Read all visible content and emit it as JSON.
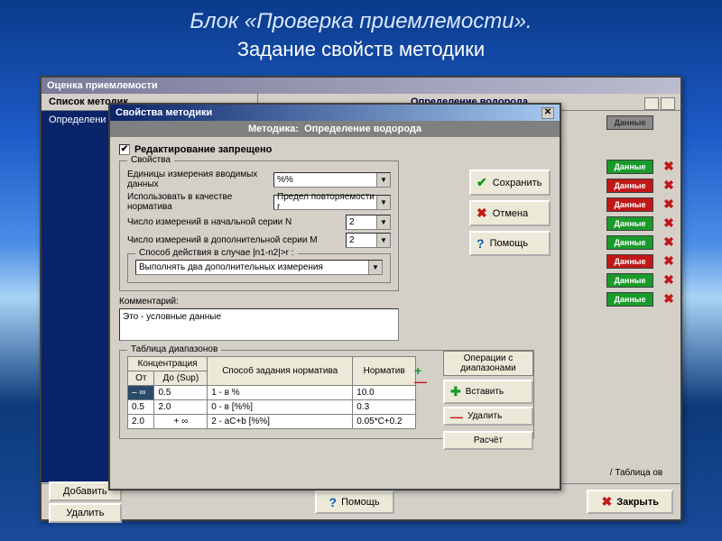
{
  "slide": {
    "title": "Блок «Проверка приемлемости».",
    "subtitle": "Задание свойств методики"
  },
  "win1": {
    "title": "Оценка приемлемости",
    "col1": "Список методик",
    "col2": "Определение водорода",
    "leftItem": "Определени",
    "buttons": [
      "Данные",
      "Данные",
      "Данные",
      "Данные",
      "Данные",
      "Данные",
      "Данные",
      "Данные",
      "Данные"
    ],
    "states": [
      "gray",
      "g",
      "r",
      "r",
      "g",
      "g",
      "r",
      "g",
      "g"
    ],
    "add": "Добавить",
    "del": "Удалить",
    "help": "Помощь",
    "close": "Закрыть",
    "note": "/ Таблица ов"
  },
  "win2": {
    "title": "Свойства методики",
    "methodLabel": "Методика:",
    "methodName": "Определение водорода",
    "readonly": "Редактирование запрещено",
    "saveBtn": "Сохранить",
    "cancelBtn": "Отмена",
    "helpBtn": "Помощь",
    "props": {
      "legend": "Свойства",
      "units": "Единицы измерения вводимых данных",
      "unitsVal": "%%",
      "norm": "Использовать в качестве норматива",
      "normVal": "Предел повторяемости r",
      "nLabel": "Число измерений в начальной серии N",
      "nVal": "2",
      "mLabel": "Число измерений в дополнительной серии M",
      "mVal": "2",
      "mode": "Способ действия в случае |n1-n2|>r :",
      "modeVal": "Выполнять два дополнительных измерения"
    },
    "commentLabel": "Комментарий:",
    "comment": "Это - условные данные",
    "table": {
      "legend": "Таблица диапазонов",
      "conc": "Концентрация",
      "from": "От",
      "to": "До (Sup)",
      "method": "Способ задания норматива",
      "norm": "Норматив",
      "rows": [
        {
          "from": "– ∞",
          "to": "0.5",
          "m": "1 - в %",
          "n": "10.0",
          "dark": true
        },
        {
          "from": "0.5",
          "to": "2.0",
          "m": "0 - в [%%]",
          "n": "0.3"
        },
        {
          "from": "2.0",
          "to": "+ ∞",
          "m": "2 - aC+b [%%]",
          "n": "0.05*C+0.2"
        }
      ],
      "opsHdr": "Операции с диапазонами",
      "ins": "Вставить",
      "del": "Удалить",
      "calc": "Расчёт"
    }
  }
}
